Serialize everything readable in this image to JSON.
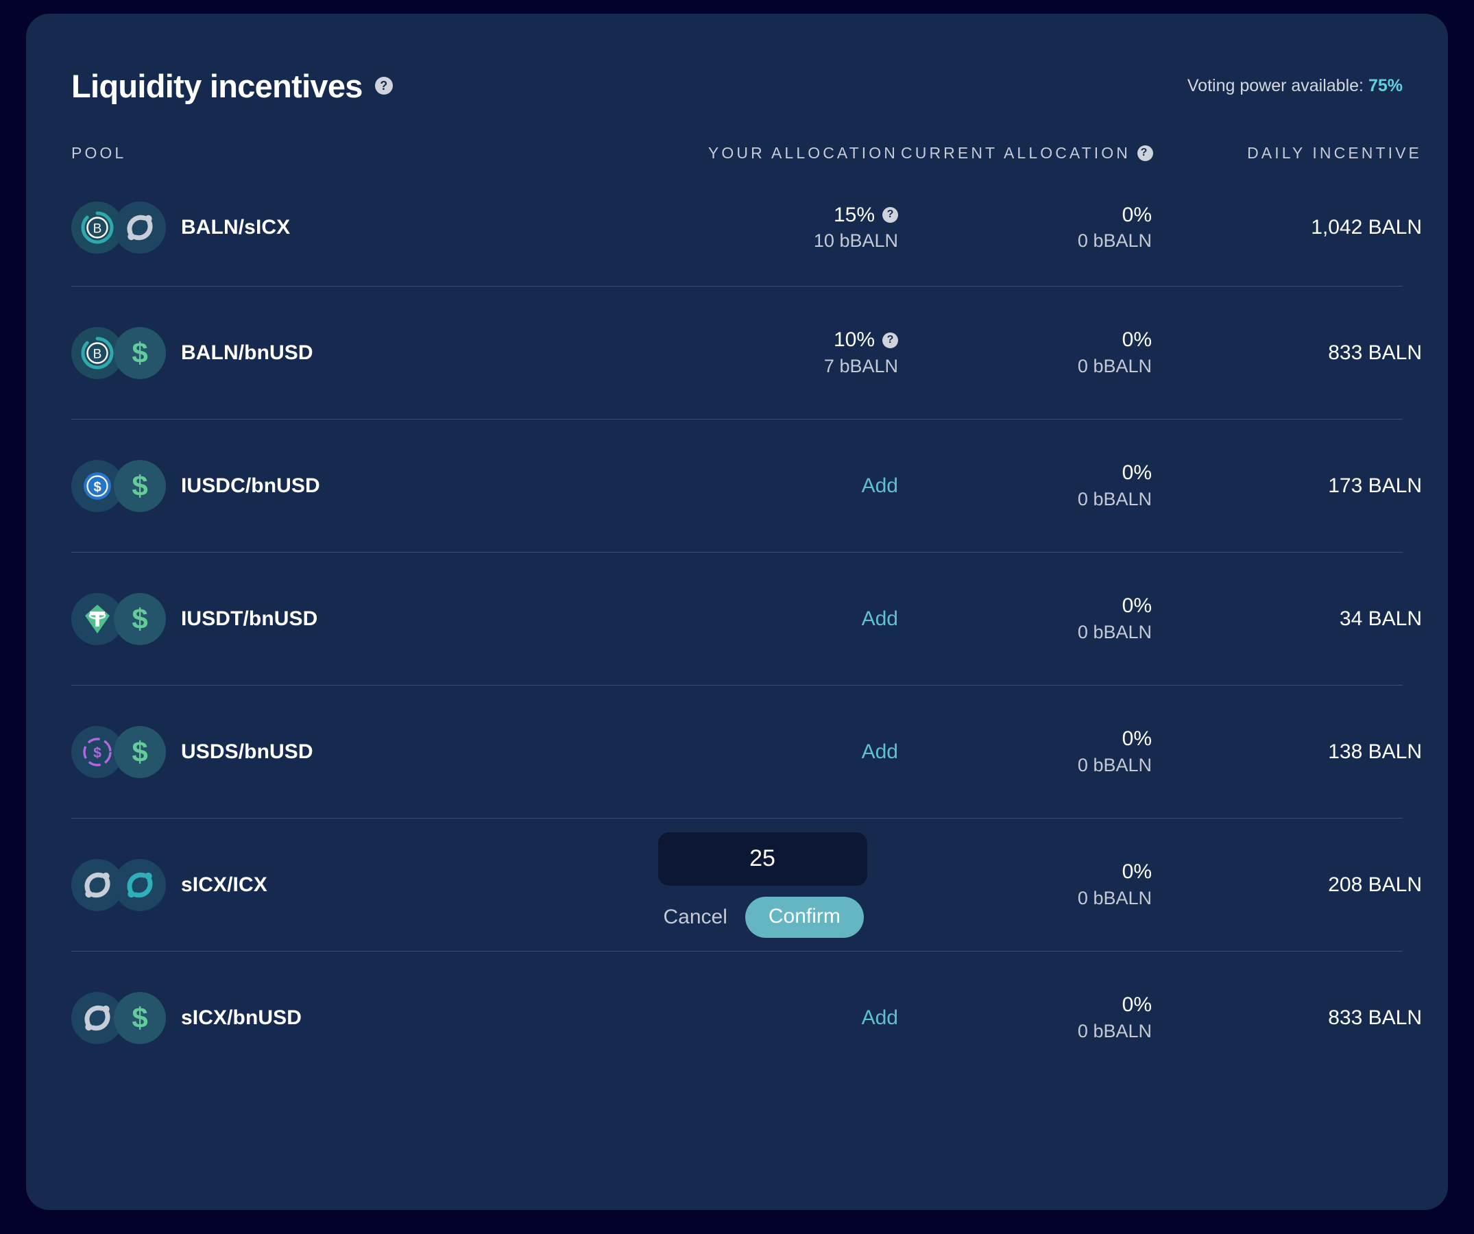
{
  "header": {
    "title": "Liquidity incentives",
    "title_help_icon": "help-circle-icon",
    "voting_power_label": "Voting power available:",
    "voting_power_value": "75%",
    "voting_power_color": "#62d0df"
  },
  "table": {
    "columns": {
      "pool": "POOL",
      "your_allocation": "YOUR ALLOCATION",
      "current_allocation": "CURRENT ALLOCATION",
      "current_allocation_help_icon": "help-circle-icon",
      "daily_incentive": "DAILY INCENTIVE"
    },
    "add_label": "Add",
    "editor": {
      "value": "25",
      "cancel_label": "Cancel",
      "confirm_label": "Confirm",
      "confirm_color": "#64b6c2"
    },
    "rows": [
      {
        "pool": "BALN/sICX",
        "icon_a": "baln-token-icon",
        "icon_b": "sicx-token-icon",
        "your_allocation_mode": "value",
        "your_allocation_pct": "15%",
        "your_allocation_help_icon": "help-circle-icon",
        "your_allocation_amount": "10 bBALN",
        "current_allocation_pct": "0%",
        "current_allocation_amount": "0 bBALN",
        "daily_incentive": "1,042 BALN"
      },
      {
        "pool": "BALN/bnUSD",
        "icon_a": "baln-token-icon",
        "icon_b": "bnusd-token-icon",
        "your_allocation_mode": "value",
        "your_allocation_pct": "10%",
        "your_allocation_help_icon": "help-circle-icon",
        "your_allocation_amount": "7 bBALN",
        "current_allocation_pct": "0%",
        "current_allocation_amount": "0 bBALN",
        "daily_incentive": "833 BALN"
      },
      {
        "pool": "IUSDC/bnUSD",
        "icon_a": "iusdc-token-icon",
        "icon_b": "bnusd-token-icon",
        "your_allocation_mode": "add",
        "current_allocation_pct": "0%",
        "current_allocation_amount": "0 bBALN",
        "daily_incentive": "173 BALN"
      },
      {
        "pool": "IUSDT/bnUSD",
        "icon_a": "iusdt-token-icon",
        "icon_b": "bnusd-token-icon",
        "your_allocation_mode": "add",
        "current_allocation_pct": "0%",
        "current_allocation_amount": "0 bBALN",
        "daily_incentive": "34 BALN"
      },
      {
        "pool": "USDS/bnUSD",
        "icon_a": "usds-token-icon",
        "icon_b": "bnusd-token-icon",
        "your_allocation_mode": "add",
        "current_allocation_pct": "0%",
        "current_allocation_amount": "0 bBALN",
        "daily_incentive": "138 BALN"
      },
      {
        "pool": "sICX/ICX",
        "icon_a": "sicx-token-icon",
        "icon_b": "icx-token-icon",
        "your_allocation_mode": "editor",
        "current_allocation_pct": "0%",
        "current_allocation_amount": "0 bBALN",
        "daily_incentive": "208 BALN"
      },
      {
        "pool": "sICX/bnUSD",
        "icon_a": "sicx-token-icon",
        "icon_b": "bnusd-token-icon",
        "your_allocation_mode": "add",
        "current_allocation_pct": "0%",
        "current_allocation_amount": "0 bBALN",
        "daily_incentive": "833 BALN"
      }
    ]
  }
}
